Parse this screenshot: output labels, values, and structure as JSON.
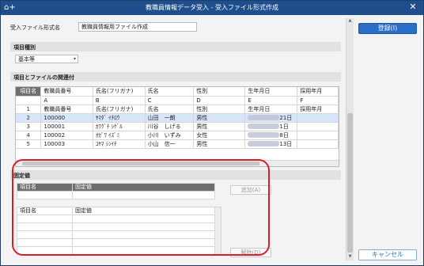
{
  "window": {
    "title": "教職員情報データ受入 - 受入ファイル形式作成",
    "app_icon": "⌂+",
    "close_symbol": "✕"
  },
  "form": {
    "file_name_label": "受入ファイル形式名",
    "file_name_value": "教職員情報用ファイル作成"
  },
  "sections": {
    "item_type": "項目種別",
    "mapping": "項目とファイルの関連付",
    "fixed": "固定値"
  },
  "item_type_select": {
    "value": "基本等",
    "chevron": "▾"
  },
  "grid": {
    "columns": [
      {
        "label": "項目名",
        "letter": "",
        "num": ""
      },
      {
        "label": "教職員番号",
        "letter": "A",
        "num": "教職員番号"
      },
      {
        "label": "氏名(フリガナ)",
        "letter": "B",
        "num": "氏名(フリガナ)"
      },
      {
        "label": "氏名",
        "letter": "C",
        "num": "氏名"
      },
      {
        "label": "性別",
        "letter": "D",
        "num": "性別"
      },
      {
        "label": "生年月日",
        "letter": "E",
        "num": "生年月日"
      },
      {
        "label": "採用年月",
        "letter": "F",
        "num": "採用年月"
      }
    ],
    "rows": [
      {
        "no": "1",
        "cells": [
          "教職員番号",
          "氏名(フリガナ)",
          "氏名",
          "性別",
          "生年月日",
          "採用年月"
        ]
      },
      {
        "no": "2",
        "cells": [
          "100000",
          "ﾔﾏﾀﾞ ｲﾁﾛｳ",
          "山田　一朗",
          "男性",
          "21日",
          ""
        ]
      },
      {
        "no": "3",
        "cells": [
          "100001",
          "ｶﾜｸﾞﾁ ｼｹﾞﾙ",
          "川谷　しげる",
          "男性",
          "1日",
          ""
        ]
      },
      {
        "no": "4",
        "cells": [
          "100002",
          "ｵｶﾞﾜ ｲｽﾞﾐ",
          "小川　いずみ",
          "女性",
          "8日",
          ""
        ]
      },
      {
        "no": "5",
        "cells": [
          "100003",
          "ｺﾔﾏ ｼﾝｲﾁ",
          "小山　信一",
          "男性",
          "13日",
          ""
        ]
      }
    ]
  },
  "fixed_table_top": {
    "col1": "項目名",
    "col2": "固定値"
  },
  "fixed_table_list": {
    "col1": "項目名",
    "col2": "固定値"
  },
  "buttons": {
    "add": "追加(A)",
    "remove": "解除(D)",
    "register": "登録(I)",
    "cancel": "キャンセル"
  }
}
